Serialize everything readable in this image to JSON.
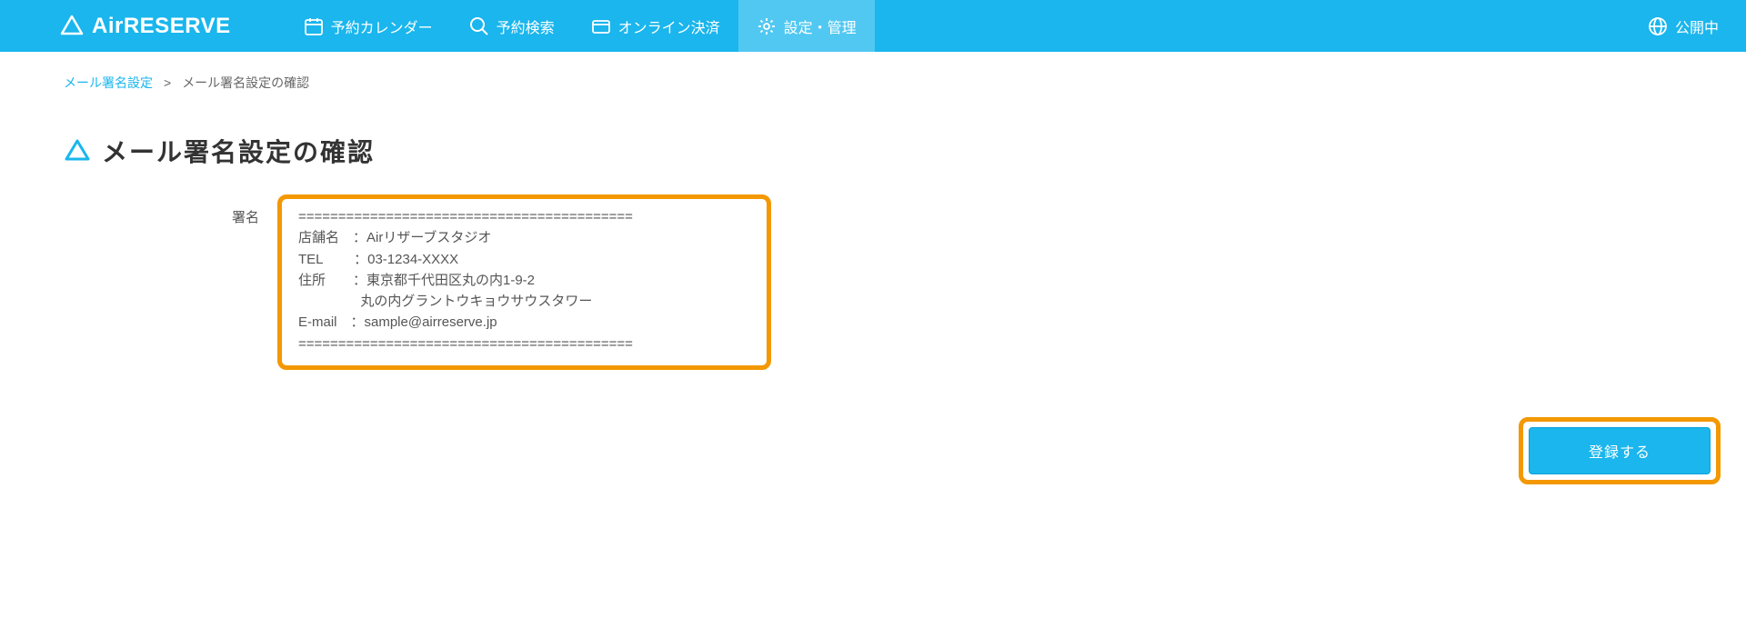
{
  "header": {
    "logo_text": "AirRESERVE",
    "nav": [
      {
        "label": "予約カレンダー",
        "icon": "calendar-icon"
      },
      {
        "label": "予約検索",
        "icon": "search-icon"
      },
      {
        "label": "オンライン決済",
        "icon": "card-icon"
      },
      {
        "label": "設定・管理",
        "icon": "gear-icon",
        "active": true
      }
    ],
    "status": "公開中"
  },
  "breadcrumb": {
    "link": "メール署名設定",
    "separator": ">",
    "current": "メール署名設定の確認"
  },
  "page": {
    "title": "メール署名設定の確認",
    "form_label": "署名",
    "signature_text": "==========================================\n店舗名　：Airリザーブスタジオ\nTEL　　 ：03-1234-XXXX\n住所　　：東京都千代田区丸の内1-9-2\n　　 　　 丸の内グラントウキョウサウスタワー\nE-mail　：sample@airreserve.jp\n=========================================="
  },
  "actions": {
    "submit": "登録する"
  }
}
